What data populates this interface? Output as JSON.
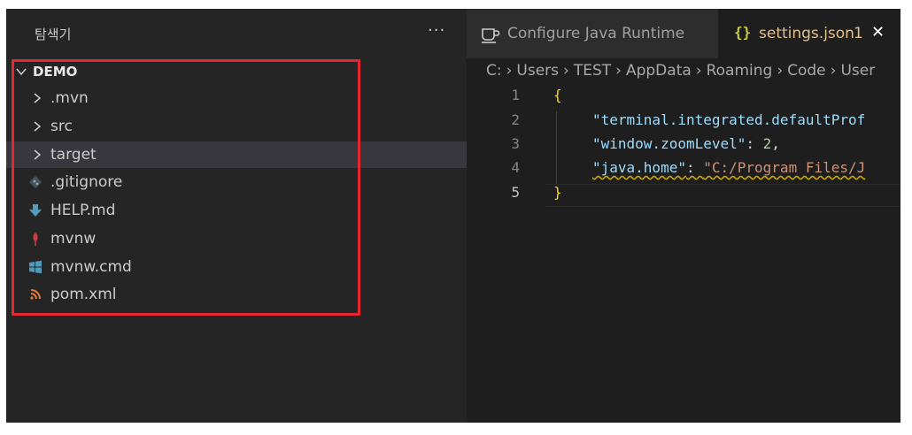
{
  "sidebar": {
    "title": "탐색기",
    "more_label": "···",
    "folder": "DEMO",
    "items": [
      {
        "label": ".mvn",
        "kind": "folder",
        "icon": "chevron-right-icon"
      },
      {
        "label": "src",
        "kind": "folder",
        "icon": "chevron-right-icon"
      },
      {
        "label": "target",
        "kind": "folder",
        "icon": "chevron-right-icon"
      },
      {
        "label": ".gitignore",
        "kind": "file",
        "icon": "git-icon"
      },
      {
        "label": "HELP.md",
        "kind": "file",
        "icon": "markdown-arrow-icon"
      },
      {
        "label": "mvnw",
        "kind": "file",
        "icon": "maven-feather-icon"
      },
      {
        "label": "mvnw.cmd",
        "kind": "file",
        "icon": "windows-icon"
      },
      {
        "label": "pom.xml",
        "kind": "file",
        "icon": "rss-icon"
      }
    ]
  },
  "tabs": [
    {
      "label": "Configure Java Runtime",
      "icon": "coffee-cup-icon",
      "active": false
    },
    {
      "label": "settings.json",
      "icon": "json-braces-icon",
      "badge": "1",
      "close": "✕",
      "active": true
    }
  ],
  "breadcrumb": [
    "C:",
    "Users",
    "TEST",
    "AppData",
    "Roaming",
    "Code",
    "User"
  ],
  "editor": {
    "line_numbers": [
      "1",
      "2",
      "3",
      "4",
      "5"
    ],
    "lines": {
      "l1_brace": "{",
      "l2_key": "\"terminal.integrated.defaultProf",
      "l3_key": "\"window.zoomLevel\"",
      "l3_colon": ": ",
      "l3_value": "2",
      "l3_comma": ",",
      "l4_key": "\"java.home\"",
      "l4_colon": ": ",
      "l4_value": "\"C:/Program Files/J",
      "l5_brace": "}"
    }
  },
  "colors": {
    "sidebar_bg": "#252526",
    "editor_bg": "#1e1e1e",
    "highlight_border": "#e3262f",
    "json_key": "#9cdcfe",
    "json_string": "#ce9178",
    "json_number": "#b5cea8",
    "brace": "#ffd700",
    "modified_tab": "#e2c08d"
  }
}
